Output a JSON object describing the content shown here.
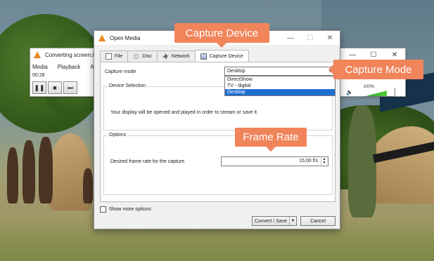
{
  "converting_window": {
    "title": "Converting screen://",
    "menu": [
      "Media",
      "Playback",
      "Au"
    ],
    "time": "00:28",
    "controls": {
      "pause": "❚❚",
      "stop": "■",
      "next": "⏭"
    },
    "window_buttons": {
      "minimize": "—",
      "maximize": "☐",
      "close": "✕"
    },
    "volume_label": "100%",
    "volume_level": 1.0,
    "speaker_icon": "speaker-icon"
  },
  "dialog": {
    "title": "Open Media",
    "window_buttons": {
      "minimize": "—",
      "maximize": "☐",
      "close": "✕"
    },
    "tabs": [
      {
        "label": "File",
        "icon": "file-icon"
      },
      {
        "label": "Disc",
        "icon": "disc-icon"
      },
      {
        "label": "Network",
        "icon": "network-icon"
      },
      {
        "label": "Capture Device",
        "icon": "capture-icon",
        "active": true
      }
    ],
    "capture_mode_label": "Capture mode",
    "capture_mode_value": "Desktop",
    "capture_mode_options": [
      "DirectShow",
      "TV - digital",
      "Desktop"
    ],
    "device_selection": {
      "legend": "Device Selection",
      "text": "Your display will be opened and played in order to stream or save it."
    },
    "options": {
      "legend": "Options",
      "fps_label": "Desired frame rate for the capture.",
      "fps_value": "15,00 f/s"
    },
    "show_more_label": "Show more options",
    "convert_button": "Convert / Save",
    "cancel_button": "Cancel"
  },
  "callouts": {
    "capture_device": "Capture Device",
    "capture_mode": "Capture Mode",
    "frame_rate": "Frame Rate"
  },
  "colors": {
    "callout": "#f0845a",
    "selection": "#1f6fd1",
    "vlc_orange": "#f39c12"
  }
}
